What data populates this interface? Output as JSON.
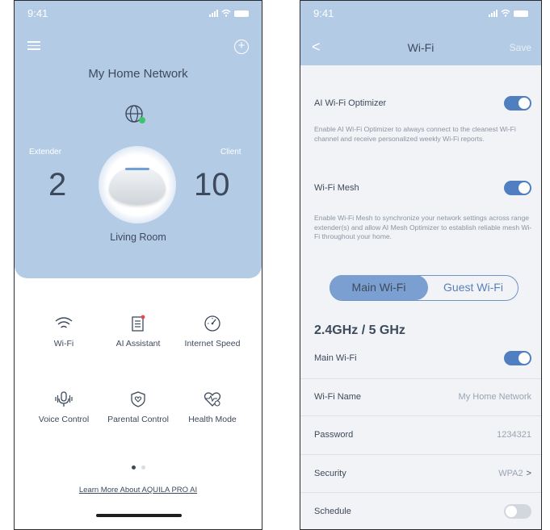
{
  "home": {
    "time": "9:41",
    "network_name": "My Home Network",
    "extender_label": "Extender",
    "extender_count": "2",
    "client_label": "Client",
    "client_count": "10",
    "room": "Living Room",
    "features": [
      {
        "label": "Wi-Fi",
        "icon": "wifi-icon"
      },
      {
        "label": "AI Assistant",
        "icon": "document-icon"
      },
      {
        "label": "Internet Speed",
        "icon": "speedometer-icon"
      },
      {
        "label": "Voice Control",
        "icon": "microphone-icon"
      },
      {
        "label": "Parental Control",
        "icon": "shield-heart-icon"
      },
      {
        "label": "Health Mode",
        "icon": "heart-monitor-icon"
      }
    ],
    "learn_more": "Learn More About AQUILA PRO AI",
    "page_indicator": {
      "current": 1,
      "total": 2
    }
  },
  "wifi": {
    "time": "9:41",
    "back": "<",
    "title": "Wi-Fi",
    "save_label": "Save",
    "ai_optimizer": {
      "label": "AI Wi-Fi Optimizer",
      "enabled": true,
      "description": "Enable AI Wi-Fi Optimizer to always connect to the cleanest Wi-Fi channel and receive personalized weekly Wi-Fi reports."
    },
    "mesh": {
      "label": "Wi-Fi Mesh",
      "enabled": true,
      "description": "Enable Wi-Fi Mesh to synchronize your network settings across range extender(s) and allow AI Mesh Optimizer to establish reliable mesh Wi-Fi throughout your home."
    },
    "tabs": {
      "main": "Main Wi-Fi",
      "guest": "Guest Wi-Fi",
      "selected": "Main Wi-Fi"
    },
    "band": "2.4GHz / 5 GHz",
    "main_wifi": {
      "label": "Main Wi-Fi",
      "enabled": true
    },
    "name": {
      "label": "Wi-Fi Name",
      "value": "My Home Network"
    },
    "password": {
      "label": "Password",
      "value": "1234321"
    },
    "security": {
      "label": "Security",
      "value": "WPA2",
      "chevron": ">"
    },
    "schedule": {
      "label": "Schedule",
      "enabled": false
    }
  },
  "colors": {
    "header_blue": "#b4cbe6",
    "toggle_on": "#4f7fc0",
    "toggle_off": "#d2d7de",
    "segment_selected": "#7a9fd0",
    "text": "#3d4a5c",
    "muted": "#9aa4b2",
    "online_dot": "#3cc46a"
  }
}
